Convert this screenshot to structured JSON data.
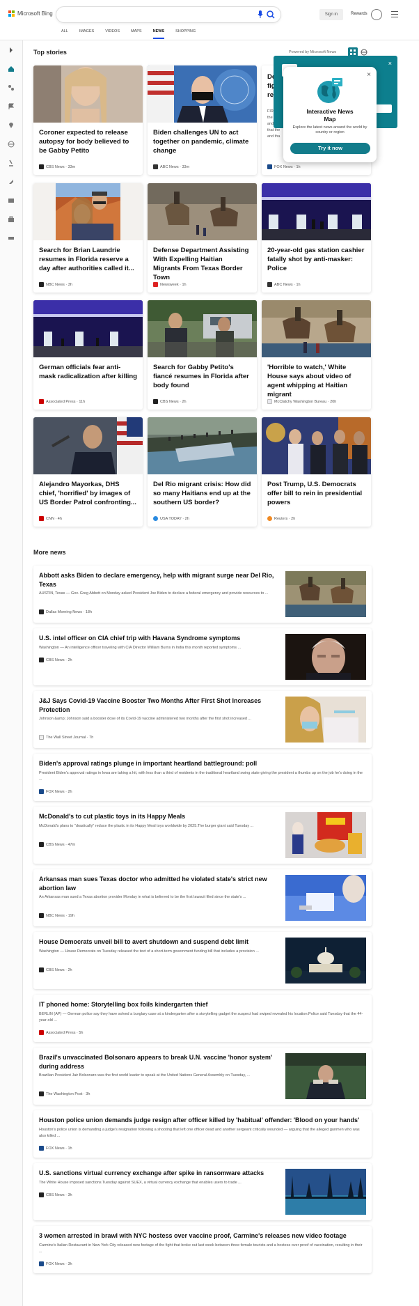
{
  "header": {
    "logo_text": "Microsoft Bing",
    "sign_in": "Sign in",
    "rewards": "Rewards",
    "tabs": [
      "ALL",
      "IMAGES",
      "VIDEOS",
      "MAPS",
      "NEWS",
      "SHOPPING"
    ],
    "active_tab": "NEWS"
  },
  "colors": {
    "accent": "#174ae4",
    "teal": "#137c8b"
  },
  "top_stories": {
    "title": "Top stories",
    "powered": "Powered by Microsoft News"
  },
  "popup": {
    "title_line1": "Interactive News",
    "title_line2": "Map",
    "desc": "Explore the latest news around the world by country or region",
    "button": "Try it now",
    "close": "×",
    "behind_title_line1": "De",
    "behind_title_line2": "fig",
    "behind_title_line3": "re",
    "behind_snippet_1": "FIR",
    "behind_snippet_2": "the do",
    "behind_snippet_3": "and Bri",
    "behind_snippet_4": "that the",
    "behind_snippet_5": "and tha",
    "behind_source": "FOX News · 1h"
  },
  "cards": [
    {
      "title": "Coroner expected to release autopsy for body believed to be Gabby Petito",
      "source": "CBS News · 33m"
    },
    {
      "title": "Biden challenges UN to act together on pandemic, climate change",
      "source": "ABC News · 33m"
    },
    {
      "title": "Search for Brian Laundrie resumes in Florida reserve a day after authorities called it...",
      "source": "NBC News · 3h"
    },
    {
      "title": "Defense Department Assisting With Expelling Haitian Migrants From Texas Border Town",
      "source": "Newsweek · 1h"
    },
    {
      "title": "20-year-old gas station cashier fatally shot by anti-masker: Police",
      "source": "ABC News · 1h"
    },
    {
      "title": "German officials fear anti-mask radicalization after killing",
      "source": "Associated Press · 11h"
    },
    {
      "title": "Search for Gabby Petito's fiancé resumes in Florida after body found",
      "source": "CBS News · 2h"
    },
    {
      "title": "'Horrible to watch,' White House says about video of agent whipping at Haitian migrant",
      "source": "McClatchy Washington Bureau · 20h"
    },
    {
      "title": "Alejandro Mayorkas, DHS chief, 'horrified' by images of US Border Patrol confronting...",
      "source": "CNN · 4h"
    },
    {
      "title": "Del Rio migrant crisis: How did so many Haitians end up at the southern US border?",
      "source": "USA TODAY · 2h"
    },
    {
      "title": "Post Trump, U.S. Democrats offer bill to rein in presidential powers",
      "source": "Reuters · 2h"
    }
  ],
  "more_news": {
    "title": "More news",
    "items": [
      {
        "title": "Abbott asks Biden to declare emergency, help with migrant surge near Del Rio, Texas",
        "snippet": "AUSTIN, Texas — Gov. Greg Abbott on Monday asked President Joe Biden to declare a federal emergency and provide resources to ...",
        "source": "Dallas Morning News · 18h"
      },
      {
        "title": "U.S. intel officer on CIA chief trip with Havana Syndrome symptoms",
        "snippet": "Washington — An intelligence officer traveling with CIA Director William Burns in India this month reported symptoms ...",
        "source": "CBS News · 2h"
      },
      {
        "title": "J&J Says Covid-19 Vaccine Booster Two Months After First Shot Increases Protection",
        "snippet": "Johnson &amp; Johnson said a booster dose of its Covid-19 vaccine administered two months after the first shot increased ...",
        "source": "The Wall Street Journal · 7h"
      },
      {
        "title": "Biden's approval ratings plunge in important heartland battleground: poll",
        "snippet": "President Biden's approval ratings in Iowa are taking a hit, with less than a third of residents in the traditional heartland swing state giving the president a thumbs up on the job he's doing in the ...",
        "source": "FOX News · 2h"
      },
      {
        "title": "McDonald's to cut plastic toys in its Happy Meals",
        "snippet": "McDonald's plans to \"drastically\" reduce the plastic in its Happy Meal toys worldwide by 2025.The burger giant said Tuesday ...",
        "source": "CBS News · 47m"
      },
      {
        "title": "Arkansas man sues Texas doctor who admitted he violated state's strict new abortion law",
        "snippet": "An Arkansas man sued a Texas abortion provider Monday in what is believed to be the first lawsuit filed since the state's ...",
        "source": "NBC News · 19h"
      },
      {
        "title": "House Democrats unveil bill to avert shutdown and suspend debt limit",
        "snippet": "Washington — House Democrats on Tuesday released the text of a short-term government funding bill that includes a provision ...",
        "source": "CBS News · 2h"
      },
      {
        "title": "IT phoned home: Storytelling box foils kindergarten thief",
        "snippet": "BERLIN (AP) — German police say they have solved a burglary case at a kindergarten after a storytelling gadget the suspect had swiped revealed his location.Police said Tuesday that the 44-year-old ...",
        "source": "Associated Press · 5h"
      },
      {
        "title": "Brazil's unvaccinated Bolsonaro appears to break U.N. vaccine 'honor system' during address",
        "snippet": "Brazilian President Jair Bolsonaro was the first world leader to speak at the United Nations General Assembly on Tuesday, ...",
        "source": "The Washington Post · 3h"
      },
      {
        "title": "Houston police union demands judge resign after officer killed by 'habitual' offender: 'Blood on your hands'",
        "snippet": "Houston's police union is demanding a judge's resignation following a shooting that left one officer dead and another sergeant critically wounded — arguing that the alleged gunmen who was also killed ...",
        "source": "FOX News · 1h"
      },
      {
        "title": "U.S. sanctions virtual currency exchange after spike in ransomware attacks",
        "snippet": "The White House imposed sanctions Tuesday against SUEX, a virtual currency exchange that enables users to trade ...",
        "source": "CBS News · 3h"
      },
      {
        "title": "3 women arrested in brawl with NYC hostess over vaccine proof, Carmine's releases new video footage",
        "snippet": "Carmine's Italian Restaurant in New York City released new footage of the fight that broke out last week between three female tourists and a hostess over proof of vaccination, resulting in their ...",
        "source": "FOX News · 3h"
      }
    ]
  }
}
